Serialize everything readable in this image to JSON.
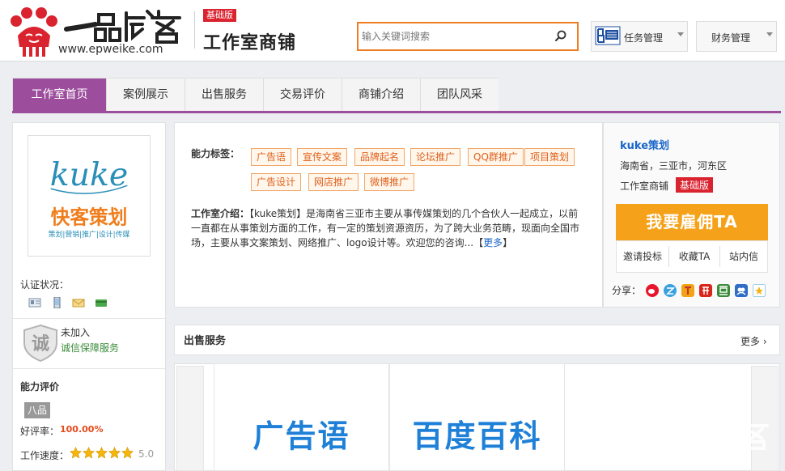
{
  "header": {
    "logo_url": "www.epweike.com",
    "edition_badge": "基础版",
    "store_title": "工作室商铺",
    "search_placeholder": "输入关键词搜索",
    "task_menu": "任务管理",
    "finance_menu": "财务管理"
  },
  "tabs": [
    {
      "label": "工作室首页"
    },
    {
      "label": "案例展示"
    },
    {
      "label": "出售服务"
    },
    {
      "label": "交易评价"
    },
    {
      "label": "商铺介绍"
    },
    {
      "label": "团队风采"
    }
  ],
  "left": {
    "auth_label": "认证状况：",
    "integrity_line1": "未加入",
    "integrity_line2": "诚信保障服务",
    "eval_title": "能力评价",
    "rank": "八品",
    "rate_label": "好评率：",
    "rate_value": "100.00%",
    "speed_label": "工作速度：",
    "speed_value": "5.0",
    "speed_stars": 5
  },
  "ability": {
    "label": "能力标签：",
    "tags": [
      "广告语",
      "宣传文案",
      "品牌起名",
      "论坛推广",
      "QQ群推广",
      "项目策划",
      "广告设计",
      "网店推广",
      "微博推广"
    ]
  },
  "intro": {
    "label": "工作室介绍：",
    "text": "【kuke策划】是海南省三亚市主要从事传媒策划的几个合伙人一起成立，以前一直都在从事策划方面的工作，有一定的策划资源资历，为了跨大业务范畴，现面向全国市场，主要从事文案策划、网络推广、logo设计等。欢迎您的咨询...",
    "more_open": "【",
    "more": "更多",
    "more_close": "】"
  },
  "profile": {
    "name": "kuke策划",
    "location": "海南省，三亚市，河东区",
    "store_label": "工作室商铺",
    "edition": "基础版",
    "hire_button": "我要雇佣TA",
    "actions": [
      "邀请投标",
      "收藏TA",
      "站内信"
    ],
    "share_label": "分享："
  },
  "sales": {
    "title": "出售服务",
    "more": "更多 ›",
    "cards": [
      "广告语",
      "百度百科"
    ]
  },
  "colors": {
    "accent_purple": "#9c4e9c",
    "orange": "#f5a21a",
    "badge_red": "#d9232f",
    "link_blue": "#1b66c9"
  }
}
